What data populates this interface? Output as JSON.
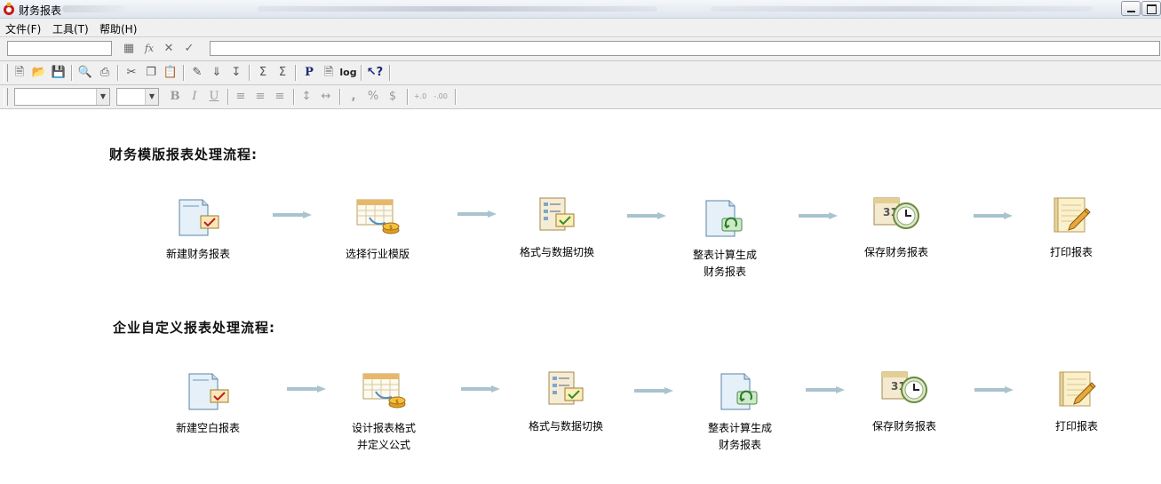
{
  "window": {
    "title": "财务报表"
  },
  "menu": {
    "items": [
      "文件(F)",
      "工具(T)",
      "帮助(H)"
    ]
  },
  "formula_bar": {
    "cell_ref": "",
    "formula": ""
  },
  "toolbar": {
    "font_name": "",
    "font_size": ""
  },
  "sections": [
    {
      "title": "财务模版报表处理流程:",
      "steps": [
        {
          "line1": "新建财务报表",
          "line2": "",
          "icon": "blank-report-icon"
        },
        {
          "line1": "选择行业模版",
          "line2": "",
          "icon": "template-calendar-icon"
        },
        {
          "line1": "格式与数据切换",
          "line2": "",
          "icon": "format-data-switch-icon"
        },
        {
          "line1": "整表计算生成",
          "line2": "财务报表",
          "icon": "calculate-report-icon"
        },
        {
          "line1": "保存财务报表",
          "line2": "",
          "icon": "save-clock-icon"
        },
        {
          "line1": "打印报表",
          "line2": "",
          "icon": "print-pencil-icon"
        }
      ]
    },
    {
      "title": "企业自定义报表处理流程:",
      "steps": [
        {
          "line1": "新建空白报表",
          "line2": "",
          "icon": "blank-report-icon"
        },
        {
          "line1": "设计报表格式",
          "line2": "并定义公式",
          "icon": "template-calendar-icon"
        },
        {
          "line1": "格式与数据切换",
          "line2": "",
          "icon": "format-data-switch-icon"
        },
        {
          "line1": "整表计算生成",
          "line2": "财务报表",
          "icon": "calculate-report-icon"
        },
        {
          "line1": "保存财务报表",
          "line2": "",
          "icon": "save-clock-icon"
        },
        {
          "line1": "打印报表",
          "line2": "",
          "icon": "print-pencil-icon"
        }
      ]
    }
  ],
  "colors": {
    "arrow": "#a9c3cf",
    "title_bar_top": "#f4f6fa",
    "title_bar_bottom": "#dfe5ee"
  }
}
